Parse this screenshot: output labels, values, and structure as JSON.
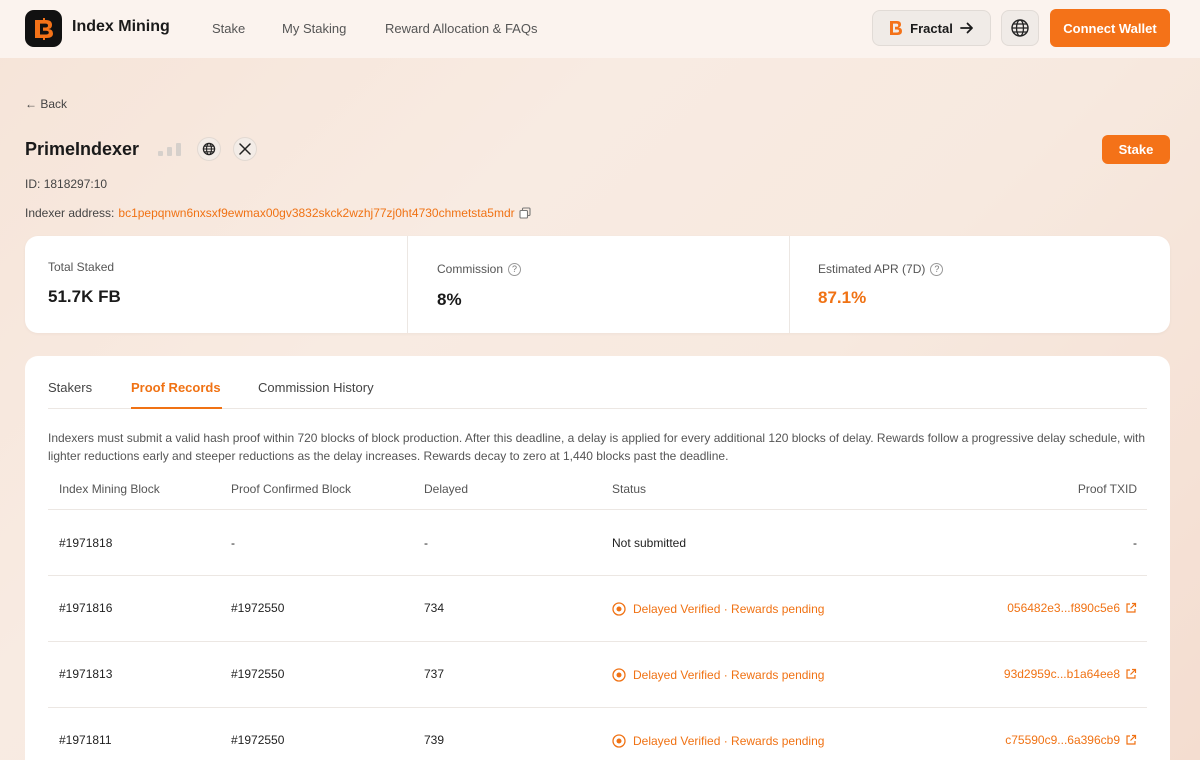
{
  "header": {
    "brand": "Index Mining",
    "nav": [
      "Stake",
      "My Staking",
      "Reward Allocation & FAQs"
    ],
    "network_label": "Fractal",
    "connect_label": "Connect Wallet"
  },
  "page": {
    "back_label": "← Back",
    "indexer_name": "PrimeIndexer",
    "stake_label": "Stake",
    "id_label": "ID:",
    "id_value": "1818297:10",
    "address_label": "Indexer address:",
    "address_value": "bc1pepqnwn6nxsxf9ewmax00gv3832skck2wzhj77zj0ht4730chmetsta5mdr"
  },
  "stats": [
    {
      "label": "Total Staked",
      "value": "51.7K FB",
      "help": false
    },
    {
      "label": "Commission",
      "value": "8%",
      "help": true
    },
    {
      "label": "Estimated APR (7D)",
      "value": "87.1%",
      "help": true
    }
  ],
  "colors": {
    "accent": "#f47218",
    "text": "#1f1f1f",
    "muted": "#555555"
  },
  "tabs": [
    "Stakers",
    "Proof Records",
    "Commission History"
  ],
  "active_tab": "Proof Records",
  "notice": "Indexers must submit a valid hash proof within 720 blocks of block production. After this deadline, a delay is applied for every additional 120 blocks of delay. Rewards follow a progressive delay schedule, with lighter reductions early and steeper reductions as the delay increases. Rewards decay to zero at 1,440 blocks past the deadline.",
  "table": {
    "columns": [
      "Index Mining Block",
      "Proof Confirmed Block",
      "Delayed",
      "Status",
      "Proof TXID"
    ],
    "rows": [
      {
        "block": "#1971818",
        "confirmed": "-",
        "delayed": "-",
        "status": "Not submitted",
        "txid": "-"
      },
      {
        "block": "#1971816",
        "confirmed": "#1972550",
        "delayed": "734",
        "status": "Delayed Verified · Rewards pending",
        "txid": "056482e3...f890c5e6"
      },
      {
        "block": "#1971813",
        "confirmed": "#1972550",
        "delayed": "737",
        "status": "Delayed Verified · Rewards pending",
        "txid": "93d2959c...b1a64ee8"
      },
      {
        "block": "#1971811",
        "confirmed": "#1972550",
        "delayed": "739",
        "status": "Delayed Verified · Rewards pending",
        "txid": "c75590c9...6a396cb9"
      }
    ]
  }
}
